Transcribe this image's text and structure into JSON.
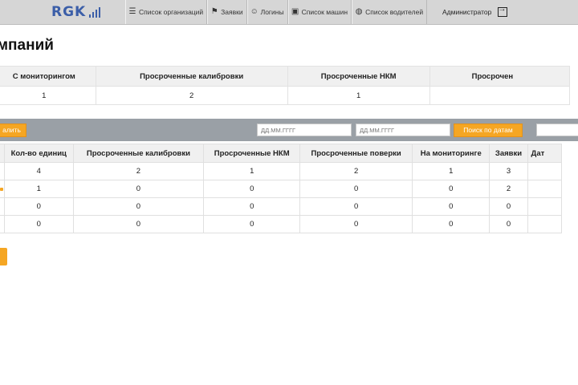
{
  "nav": {
    "logo": "RGK",
    "items": [
      {
        "label": "Список организаций",
        "icon": "list-icon"
      },
      {
        "label": "Заявки",
        "icon": "flag-icon"
      },
      {
        "label": "Логины",
        "icon": "people-icon"
      },
      {
        "label": "Список машин",
        "icon": "bus-icon"
      },
      {
        "label": "Список водителей",
        "icon": "globe-icon"
      }
    ],
    "user": "Администратор",
    "logout_icon": "logout-icon"
  },
  "page": {
    "title": "мпаний"
  },
  "summary": {
    "headers": [
      "С мониторингом",
      "Просроченные калибровки",
      "Просроченные НКМ",
      "Просрочен"
    ],
    "values": [
      "1",
      "2",
      "1",
      ""
    ]
  },
  "filters": {
    "left_button": "алить",
    "date_from_placeholder": "ДД.ММ.ГГГГ",
    "date_to_placeholder": "ДД.ММ.ГГГГ",
    "search_button": "Поиск по датам",
    "accent_color": "#f5a623"
  },
  "table": {
    "headers": [
      "Кол-во единиц",
      "Просроченные калибровки",
      "Просроченные НКМ",
      "Просроченные поверки",
      "На мониторинге",
      "Заявки",
      "Дат"
    ],
    "rows": [
      [
        "4",
        "2",
        "1",
        "2",
        "1",
        "3",
        ""
      ],
      [
        "1",
        "0",
        "0",
        "0",
        "0",
        "2",
        ""
      ],
      [
        "0",
        "0",
        "0",
        "0",
        "0",
        "0",
        ""
      ],
      [
        "0",
        "0",
        "0",
        "0",
        "0",
        "0",
        ""
      ]
    ]
  }
}
